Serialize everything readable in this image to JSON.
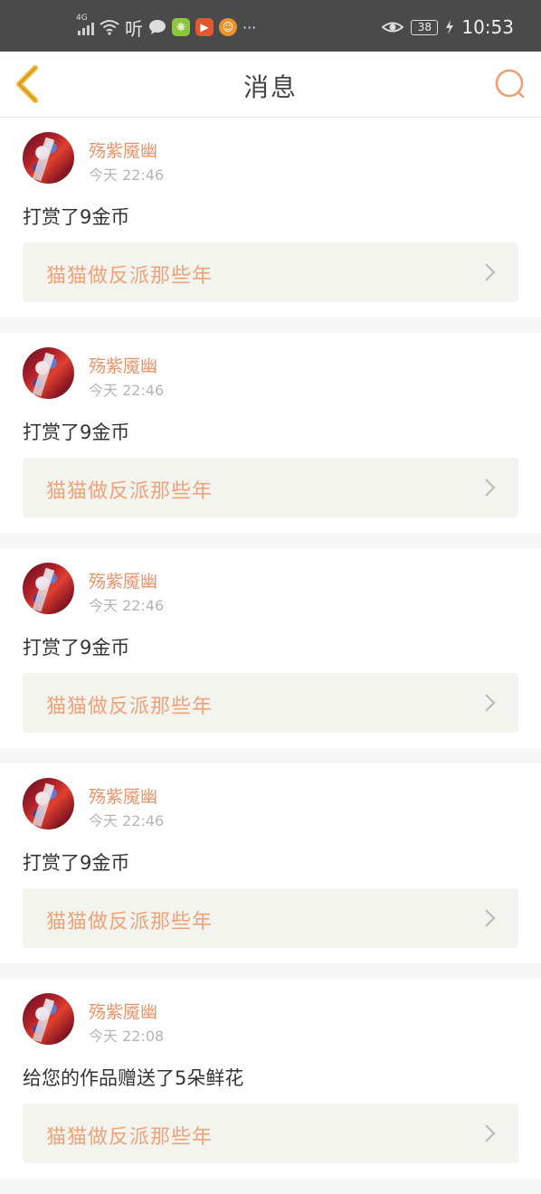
{
  "status_bar": {
    "network": "4G",
    "listen_label": "听",
    "battery": "38",
    "time": "10:53",
    "overflow": "···"
  },
  "header": {
    "title": "消息",
    "back_icon": "chevron-left-icon",
    "search_icon": "search-icon"
  },
  "colors": {
    "accent": "#e8946a",
    "work_title": "#f0a27b",
    "back_icon": "#f2b632",
    "card_bg": "#ffffff",
    "page_bg": "#f6f6f6",
    "link_bg": "#f4f4ee"
  },
  "messages": [
    {
      "user": "殇紫魇幽",
      "time": "今天 22:46",
      "text": "打赏了9金币",
      "work": "猫猫做反派那些年"
    },
    {
      "user": "殇紫魇幽",
      "time": "今天 22:46",
      "text": "打赏了9金币",
      "work": "猫猫做反派那些年"
    },
    {
      "user": "殇紫魇幽",
      "time": "今天 22:46",
      "text": "打赏了9金币",
      "work": "猫猫做反派那些年"
    },
    {
      "user": "殇紫魇幽",
      "time": "今天 22:46",
      "text": "打赏了9金币",
      "work": "猫猫做反派那些年"
    },
    {
      "user": "殇紫魇幽",
      "time": "今天 22:08",
      "text": "给您的作品赠送了5朵鲜花",
      "work": "猫猫做反派那些年"
    }
  ]
}
